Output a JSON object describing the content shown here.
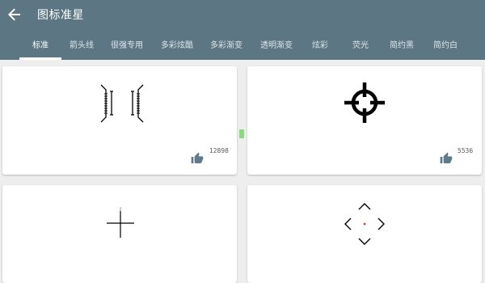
{
  "appbar": {
    "title": "图标准星",
    "back_icon": "arrow-left-icon"
  },
  "tabs": [
    {
      "label": "标准",
      "active": true
    },
    {
      "label": "箭头线",
      "active": false
    },
    {
      "label": "很强专用",
      "active": false
    },
    {
      "label": "多彩炫酷",
      "active": false
    },
    {
      "label": "多彩渐变",
      "active": false
    },
    {
      "label": "透明渐变",
      "active": false
    },
    {
      "label": "炫彩",
      "active": false
    },
    {
      "label": "荧光",
      "active": false
    },
    {
      "label": "简约黑",
      "active": false
    },
    {
      "label": "简约白",
      "active": false
    }
  ],
  "cards": [
    {
      "crosshair": "bracket-crosshair-icon",
      "likes": "12898"
    },
    {
      "crosshair": "circle-crosshair-icon",
      "likes": "5536"
    },
    {
      "crosshair": "thin-cross-crosshair-icon",
      "likes": ""
    },
    {
      "crosshair": "diamond-dashed-crosshair-icon",
      "likes": ""
    }
  ],
  "colors": {
    "appbar": "#5c7683",
    "background": "#eeeeee",
    "like_icon": "#5f7a88",
    "center_dot": "#e53935"
  }
}
